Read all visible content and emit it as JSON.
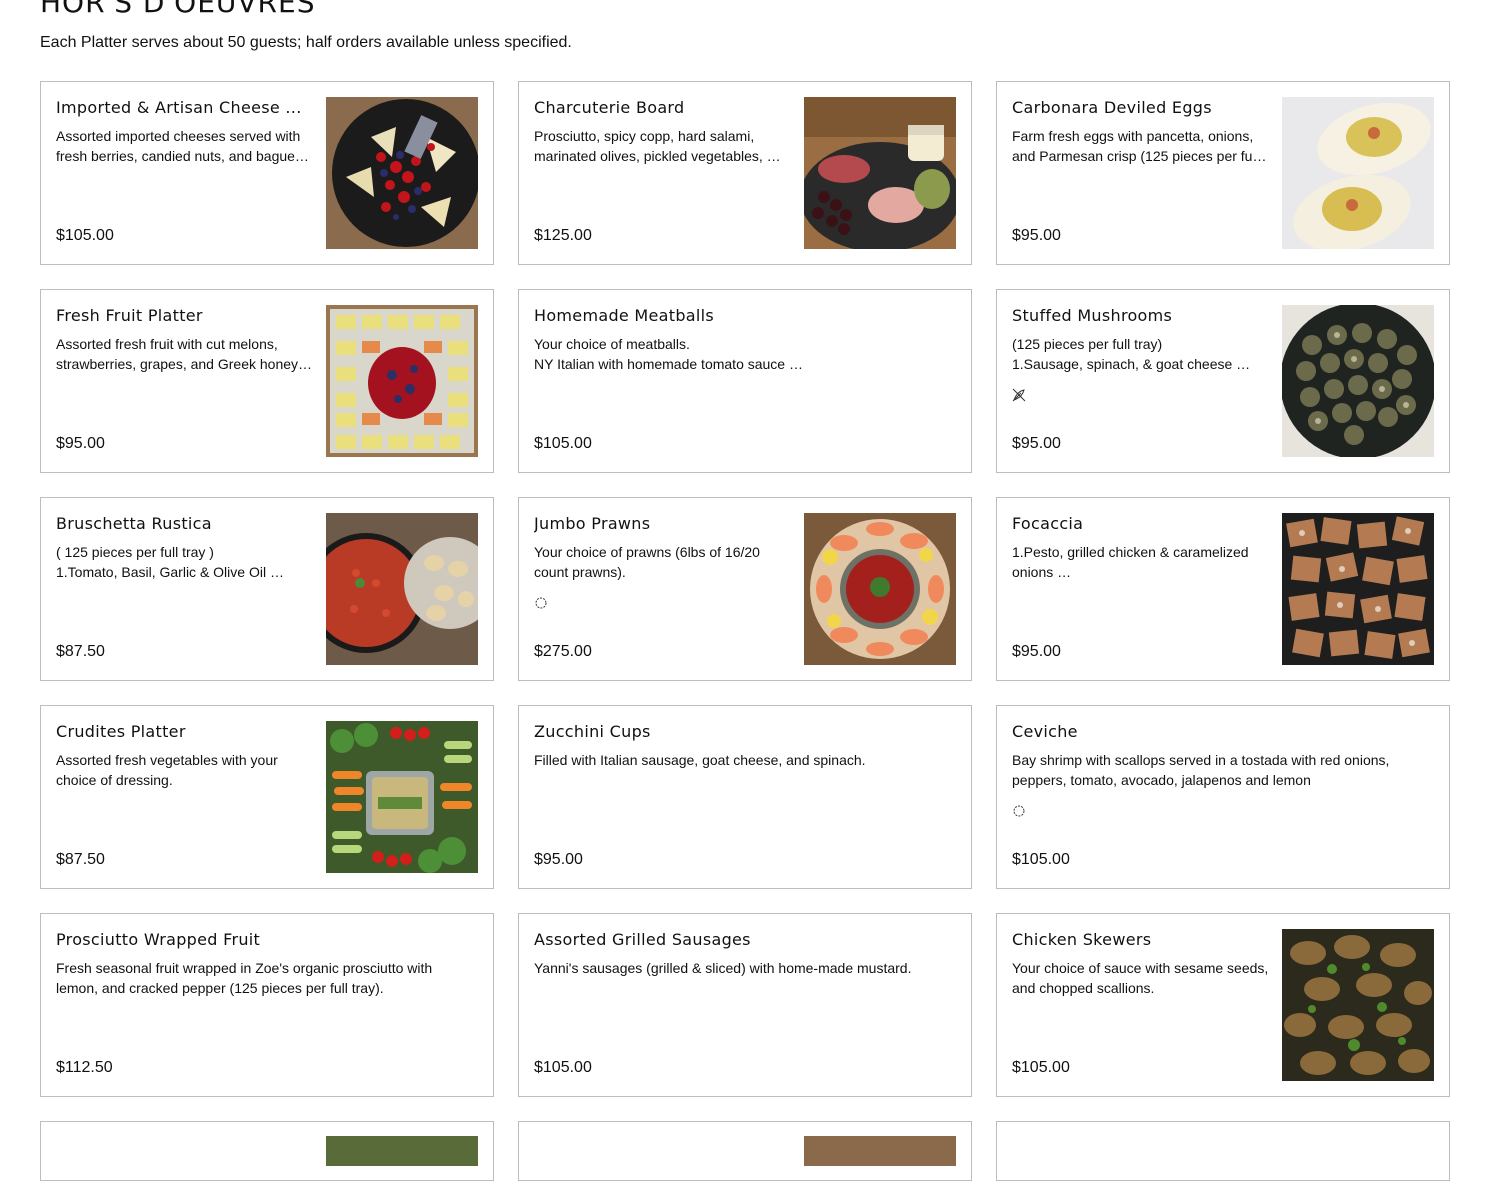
{
  "section": {
    "title": "HOR'S D'OEUVRES",
    "subtitle": "Each Platter serves about 50 guests; half orders available unless specified."
  },
  "items": [
    {
      "name": "Imported & Artisan Cheese ...",
      "desc": [
        "Assorted imported cheeses served with",
        "fresh berries, candied nuts, and bague…"
      ],
      "price": "$105.00",
      "image": "cheese-platter"
    },
    {
      "name": "Charcuterie Board",
      "desc": [
        "Prosciutto, spicy copp, hard salami,",
        "marinated olives, pickled vegetables, …"
      ],
      "price": "$125.00",
      "image": "charcuterie-board"
    },
    {
      "name": "Carbonara Deviled Eggs",
      "desc": [
        "Farm fresh eggs with pancetta, onions,",
        "and Parmesan crisp (125 pieces per fu…"
      ],
      "price": "$95.00",
      "image": "deviled-eggs"
    },
    {
      "name": "Fresh Fruit Platter",
      "desc": [
        "Assorted fresh fruit with cut melons,",
        "strawberries, grapes, and Greek honey…"
      ],
      "price": "$95.00",
      "image": "fruit-platter"
    },
    {
      "name": "Homemade  Meatballs",
      "desc": [
        "Your choice of meatballs.",
        "NY Italian with homemade tomato sauce …"
      ],
      "price": "$105.00",
      "image": null
    },
    {
      "name": "Stuffed Mushrooms",
      "desc": [
        "(125 pieces per full tray)",
        "1.Sausage, spinach, & goat cheese …"
      ],
      "price": "$95.00",
      "image": "stuffed-mushrooms",
      "badge": "vegetarian-icon"
    },
    {
      "name": "Bruschetta Rustica",
      "desc": [
        "( 125 pieces per full tray )",
        "1.Tomato, Basil, Garlic & Olive Oil …"
      ],
      "price": "$87.50",
      "image": "bruschetta"
    },
    {
      "name": "Jumbo Prawns",
      "desc": [
        "Your choice of prawns (6lbs of 16/20",
        "count prawns)."
      ],
      "price": "$275.00",
      "image": "jumbo-prawns",
      "badge": "gluten-free-icon"
    },
    {
      "name": "Focaccia",
      "desc": [
        "1.Pesto, grilled chicken & caramelized",
        "onions …"
      ],
      "price": "$95.00",
      "image": "focaccia"
    },
    {
      "name": "Crudites Platter",
      "desc": [
        "Assorted fresh vegetables with your",
        "choice of dressing."
      ],
      "price": "$87.50",
      "image": "crudites-platter"
    },
    {
      "name": "Zucchini Cups",
      "desc": [
        "Filled with Italian sausage, goat cheese, and spinach."
      ],
      "price": "$95.00",
      "image": null
    },
    {
      "name": "Ceviche",
      "desc": [
        "Bay shrimp with scallops served in a tostada with red onions,",
        "peppers, tomato, avocado, jalapenos and lemon"
      ],
      "price": "$105.00",
      "image": null,
      "badge": "gluten-free-icon"
    },
    {
      "name": "Prosciutto Wrapped Fruit",
      "desc": [
        "Fresh seasonal fruit wrapped in Zoe's organic prosciutto with",
        "lemon, and cracked pepper (125 pieces per full tray)."
      ],
      "price": "$112.50",
      "image": null
    },
    {
      "name": "Assorted Grilled Sausages",
      "desc": [
        "Yanni's sausages (grilled & sliced) with home-made mustard."
      ],
      "price": "$105.00",
      "image": null
    },
    {
      "name": "Chicken Skewers",
      "desc": [
        "Your choice of sauce with sesame seeds,",
        "and chopped scallions."
      ],
      "price": "$105.00",
      "image": "chicken-skewers"
    }
  ],
  "colors": {
    "border": "#bdbdbd",
    "text": "#111111",
    "background": "#ffffff"
  }
}
